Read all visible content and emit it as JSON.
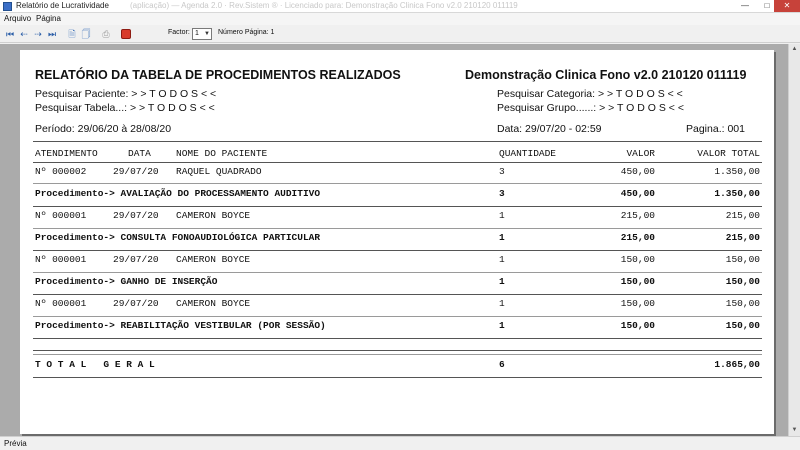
{
  "window": {
    "title": "Relatório de Lucratividade",
    "title_faded": "(aplicação) — Agenda 2.0 · Rev.Sistem ® · Licenciado para: Demonstração Clinica Fono v2.0 210120 011119"
  },
  "menu": [
    "Arquivo",
    "Página"
  ],
  "toolbar": {
    "factor_label": "Factor:",
    "factor_value": "1",
    "page_label": "Número Página: 1"
  },
  "report": {
    "title": "RELATÓRIO DA TABELA DE PROCEDIMENTOS REALIZADOS",
    "company": "Demonstração Clinica Fono v2.0 210120 011119",
    "filters": {
      "paciente": "Pesquisar Paciente: > > T O D O S < <",
      "tabela": "Pesquisar Tabela...: > > T O D O S < <",
      "categoria": "Pesquisar Categoria: > > T O D O S < <",
      "grupo": "Pesquisar Grupo......: > > T O D O S < <"
    },
    "periodo": "Período: 29/06/20 à 28/08/20",
    "data": "Data: 29/07/20 - 02:59",
    "pagina": "Pagina.: 001",
    "columns": {
      "atendimento": "ATENDIMENTO",
      "data": "DATA",
      "paciente": "NOME DO PACIENTE",
      "quantidade": "QUANTIDADE",
      "valor": "VALOR",
      "valor_total": "VALOR TOTAL"
    },
    "groups": [
      {
        "row": {
          "num": "Nº 000002",
          "date": "29/07/20",
          "name": "RAQUEL QUADRADO",
          "qty": "3",
          "valor": "450,00",
          "total": "1.350,00"
        },
        "proc": {
          "label": "Procedimento-> AVALIAÇÃO DO PROCESSAMENTO AUDITIVO",
          "qty": "3",
          "valor": "450,00",
          "total": "1.350,00"
        }
      },
      {
        "row": {
          "num": "Nº 000001",
          "date": "29/07/20",
          "name": "CAMERON BOYCE",
          "qty": "1",
          "valor": "215,00",
          "total": "215,00"
        },
        "proc": {
          "label": "Procedimento-> CONSULTA FONOAUDIOLÓGICA PARTICULAR",
          "qty": "1",
          "valor": "215,00",
          "total": "215,00"
        }
      },
      {
        "row": {
          "num": "Nº 000001",
          "date": "29/07/20",
          "name": "CAMERON BOYCE",
          "qty": "1",
          "valor": "150,00",
          "total": "150,00"
        },
        "proc": {
          "label": "Procedimento-> GANHO DE INSERÇÃO",
          "qty": "1",
          "valor": "150,00",
          "total": "150,00"
        }
      },
      {
        "row": {
          "num": "Nº 000001",
          "date": "29/07/20",
          "name": "CAMERON BOYCE",
          "qty": "1",
          "valor": "150,00",
          "total": "150,00"
        },
        "proc": {
          "label": "Procedimento-> REABILITAÇÃO VESTIBULAR (POR SESSÃO)",
          "qty": "1",
          "valor": "150,00",
          "total": "150,00"
        }
      }
    ],
    "total": {
      "label": "T O T A L   G E R A L",
      "qty": "6",
      "total": "1.865,00"
    }
  },
  "status": "Prévia"
}
